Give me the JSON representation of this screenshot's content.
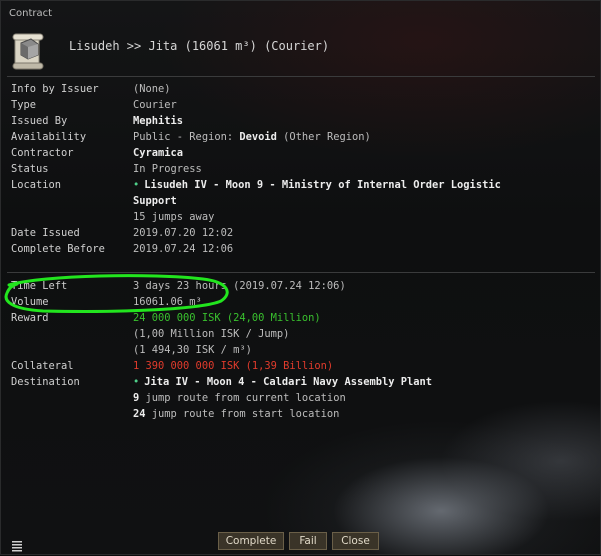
{
  "window": {
    "title": "Contract"
  },
  "header": {
    "title": "Lisudeh >> Jita (16061 m³) (Courier)"
  },
  "details": {
    "info_by_issuer": {
      "label": "Info by Issuer",
      "value": "(None)"
    },
    "type": {
      "label": "Type",
      "value": "Courier"
    },
    "issued_by": {
      "label": "Issued By",
      "value": "Mephitis"
    },
    "availability": {
      "label": "Availability",
      "prefix": "Public - Region: ",
      "region": "Devoid",
      "suffix": " (Other Region)"
    },
    "contractor": {
      "label": "Contractor",
      "value": "Cyramica"
    },
    "status": {
      "label": "Status",
      "value": "In Progress"
    },
    "location": {
      "label": "Location",
      "line1": "Lisudeh IV - Moon 9 - Ministry of Internal Order Logistic",
      "line2": "Support",
      "jumps": "15 jumps away"
    },
    "date_issued": {
      "label": "Date Issued",
      "value": "2019.07.20 12:02"
    },
    "complete_before": {
      "label": "Complete Before",
      "value": "2019.07.24 12:06"
    }
  },
  "terms": {
    "time_left": {
      "label": "Time Left",
      "value": "3 days 23 hours (2019.07.24 12:06)"
    },
    "volume": {
      "label": "Volume",
      "value": "16061.06 m³"
    },
    "reward": {
      "label": "Reward",
      "value": "24 000 000 ISK (24,00 Million)",
      "per_jump": "(1,00 Million ISK / Jump)",
      "per_m3": "(1 494,30 ISK / m³)"
    },
    "collateral": {
      "label": "Collateral",
      "value": "1 390 000 000 ISK (1,39 Billion)"
    },
    "destination": {
      "label": "Destination",
      "value": "Jita IV - Moon 4 - Caldari Navy Assembly Plant",
      "route_current_count": "9",
      "route_current_text": " jump route from current location",
      "route_start_count": "24",
      "route_start_text": " jump route from start location"
    }
  },
  "buttons": {
    "complete": "Complete",
    "fail": "Fail",
    "close": "Close"
  },
  "colors": {
    "reward_green": "#39c12e",
    "collateral_red": "#e03b2c",
    "annotation_green": "#22e51e",
    "button_gold": "#6a5f48"
  }
}
